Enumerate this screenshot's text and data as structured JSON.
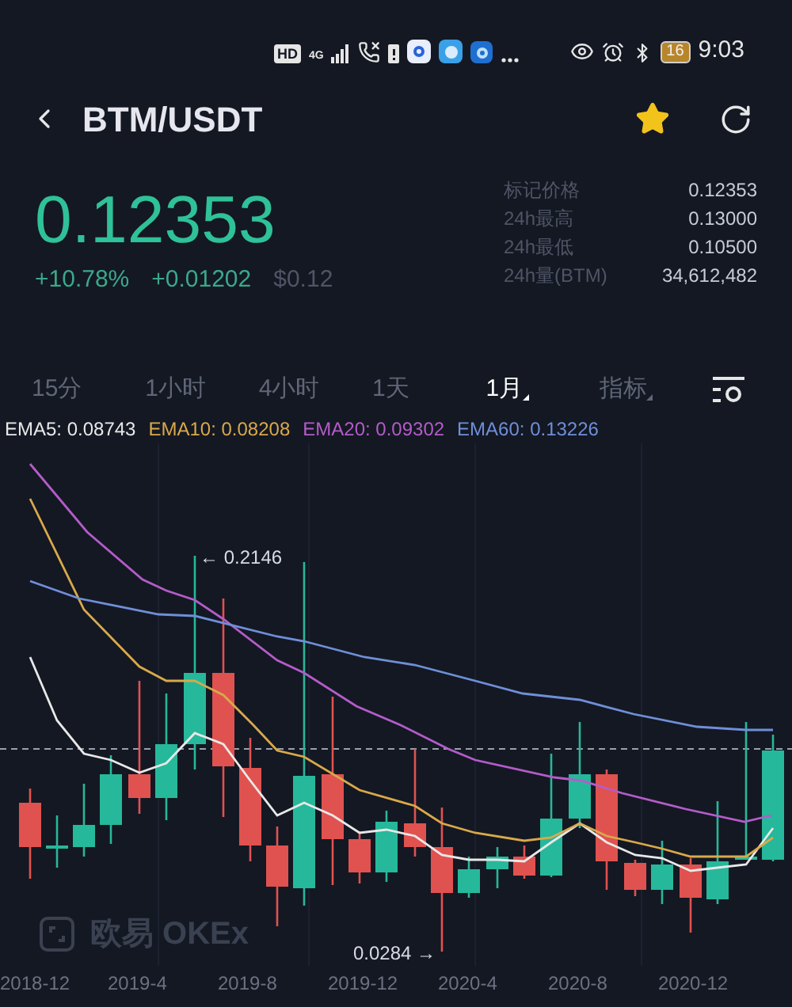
{
  "status_bar": {
    "network_badge": "HD",
    "signal_label": "4G",
    "battery": "16",
    "time": "9:03"
  },
  "header": {
    "title": "BTM/USDT",
    "favorite": true
  },
  "price": {
    "last": "0.12353",
    "change_pct": "+10.78%",
    "change_abs": "+0.01202",
    "usd": "$0.12"
  },
  "stats": [
    {
      "label": "标记价格",
      "value": "0.12353"
    },
    {
      "label": "24h最高",
      "value": "0.13000"
    },
    {
      "label": "24h最低",
      "value": "0.10500"
    },
    {
      "label": "24h量(BTM)",
      "value": "34,612,482"
    }
  ],
  "tabs": [
    {
      "label": "15分",
      "selected": false,
      "dropdown": false
    },
    {
      "label": "1小时",
      "selected": false,
      "dropdown": false
    },
    {
      "label": "4小时",
      "selected": false,
      "dropdown": false
    },
    {
      "label": "1天",
      "selected": false,
      "dropdown": false
    },
    {
      "label": "1月",
      "selected": true,
      "dropdown": true
    },
    {
      "label": "指标",
      "selected": false,
      "dropdown": true
    }
  ],
  "ema": [
    {
      "label": "EMA5: 0.08743",
      "color": "#e8e8e8"
    },
    {
      "label": "EMA10: 0.08208",
      "color": "#d9a94a"
    },
    {
      "label": "EMA20: 0.09302",
      "color": "#b45cc9"
    },
    {
      "label": "EMA60: 0.13226",
      "color": "#6f8fd8"
    }
  ],
  "chart": {
    "high_label": "← 0.2146",
    "low_label": "0.0284 →",
    "watermark": "欧易 OKEx",
    "x_labels": [
      "2018-12",
      "2019-4",
      "2019-8",
      "2019-12",
      "2020-4",
      "2020-8",
      "2020-12"
    ]
  }
}
